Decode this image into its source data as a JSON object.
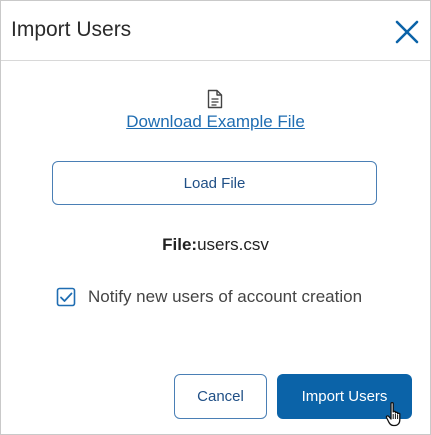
{
  "dialog": {
    "title": "Import Users"
  },
  "download": {
    "label": "Download Example File",
    "icon": "document-icon"
  },
  "load_file": {
    "label": "Load File"
  },
  "file": {
    "label": "File:",
    "name": "users.csv"
  },
  "notify": {
    "label": "Notify new users of account creation",
    "checked": true
  },
  "actions": {
    "cancel_label": "Cancel",
    "import_label": "Import Users"
  },
  "colors": {
    "accent": "#0b63a8",
    "link": "#1f6db2",
    "border": "#4a7fb5"
  }
}
